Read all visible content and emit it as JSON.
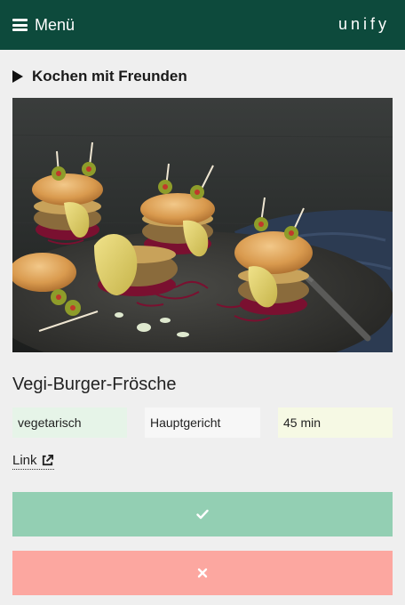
{
  "header": {
    "menu_label": "Menü",
    "brand": "unify",
    "background": "#0d4a3c",
    "icons": {
      "menu": "hamburger-icon"
    }
  },
  "section": {
    "title": "Kochen mit Freunden",
    "icon": "play-triangle-icon"
  },
  "recipe": {
    "title": "Vegi-Burger-Frösche",
    "tags": [
      {
        "label": "vegetarisch",
        "color": "#e6f4e8"
      },
      {
        "label": "Hauptgericht",
        "color": "#f7f7f7"
      },
      {
        "label": "45 min",
        "color": "#f6f9e4"
      }
    ],
    "link_label": "Link",
    "link_icon": "external-link-icon"
  },
  "actions": {
    "accept": {
      "icon": "check-icon",
      "color": "#93cfb3"
    },
    "reject": {
      "icon": "close-icon",
      "color": "#fca7a0"
    }
  }
}
